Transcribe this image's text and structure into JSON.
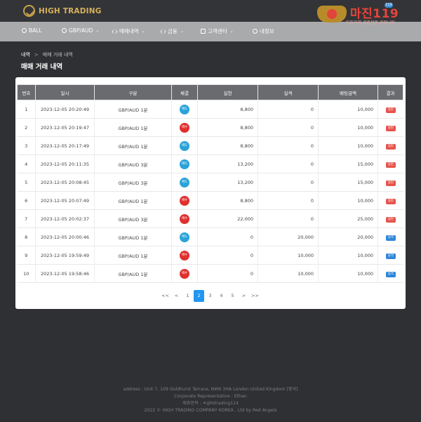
{
  "header": {
    "logo_text": "HIGH TRADING"
  },
  "watermark": {
    "title": "마진119",
    "subtitle": "마진거래 검증전문 커뮤니티",
    "badge": "119"
  },
  "nav": [
    {
      "label": "BALL",
      "icon": "ball-icon",
      "caret": ""
    },
    {
      "label": "GBP/AUD",
      "icon": "currency-icon",
      "caret": "⌄"
    },
    {
      "label": "매매내역",
      "icon": "chart-bars-icon",
      "caret": "⌄"
    },
    {
      "label": "금융",
      "icon": "finance-icon",
      "caret": "⌄"
    },
    {
      "label": "고객센터",
      "icon": "support-icon",
      "caret": "⌄"
    },
    {
      "label": "내정보",
      "icon": "user-icon",
      "caret": ""
    }
  ],
  "breadcrumb": {
    "home": "내역",
    "separator": ">",
    "current": "매매 거래 내역"
  },
  "page_title": "매매 거래 내역",
  "table": {
    "headers": [
      "번호",
      "일시",
      "구분",
      "체결",
      "실현",
      "실격",
      "배팅금액",
      "결과"
    ],
    "rows": [
      {
        "no": "1",
        "time": "2023-12-05 20:20:49",
        "type": "GBP/AUD 1분",
        "side": "매도",
        "side_kind": "sell",
        "realized": "8,800",
        "fail": "0",
        "bet": "10,000",
        "result": "실현",
        "result_kind": "loss"
      },
      {
        "no": "2",
        "time": "2023-12-05 20:19:47",
        "type": "GBP/AUD 1분",
        "side": "매수",
        "side_kind": "buy",
        "realized": "8,800",
        "fail": "0",
        "bet": "10,000",
        "result": "실현",
        "result_kind": "loss"
      },
      {
        "no": "3",
        "time": "2023-12-05 20:17:49",
        "type": "GBP/AUD 1분",
        "side": "매도",
        "side_kind": "sell",
        "realized": "8,800",
        "fail": "0",
        "bet": "10,000",
        "result": "실현",
        "result_kind": "loss"
      },
      {
        "no": "4",
        "time": "2023-12-05 20:11:35",
        "type": "GBP/AUD 3분",
        "side": "매도",
        "side_kind": "sell",
        "realized": "13,200",
        "fail": "0",
        "bet": "15,000",
        "result": "실현",
        "result_kind": "loss"
      },
      {
        "no": "5",
        "time": "2023-12-05 20:08:45",
        "type": "GBP/AUD 3분",
        "side": "매도",
        "side_kind": "sell",
        "realized": "13,200",
        "fail": "0",
        "bet": "15,000",
        "result": "실현",
        "result_kind": "loss"
      },
      {
        "no": "6",
        "time": "2023-12-05 20:07:49",
        "type": "GBP/AUD 1분",
        "side": "매수",
        "side_kind": "buy",
        "realized": "8,800",
        "fail": "0",
        "bet": "10,000",
        "result": "실현",
        "result_kind": "loss"
      },
      {
        "no": "7",
        "time": "2023-12-05 20:02:37",
        "type": "GBP/AUD 3분",
        "side": "매수",
        "side_kind": "buy",
        "realized": "22,000",
        "fail": "0",
        "bet": "25,000",
        "result": "실현",
        "result_kind": "loss"
      },
      {
        "no": "8",
        "time": "2023-12-05 20:00:46",
        "type": "GBP/AUD 1분",
        "side": "매도",
        "side_kind": "sell",
        "realized": "0",
        "fail": "20,000",
        "bet": "20,000",
        "result": "실격",
        "result_kind": "win"
      },
      {
        "no": "9",
        "time": "2023-12-05 19:59:49",
        "type": "GBP/AUD 1분",
        "side": "매수",
        "side_kind": "buy",
        "realized": "0",
        "fail": "10,000",
        "bet": "10,000",
        "result": "실격",
        "result_kind": "win"
      },
      {
        "no": "10",
        "time": "2023-12-05 19:58:46",
        "type": "GBP/AUD 1분",
        "side": "매수",
        "side_kind": "buy",
        "realized": "0",
        "fail": "10,000",
        "bet": "10,000",
        "result": "실격",
        "result_kind": "win"
      }
    ]
  },
  "pagination": {
    "first": "<<",
    "prev": "<",
    "pages": [
      "1",
      "2",
      "3",
      "4",
      "5"
    ],
    "current": "2",
    "next": ">",
    "last": ">>"
  },
  "footer": {
    "address": "address : Unit 7, 109 Goldhurst Terrace, NW6 3HA London United Kingdom [영국]",
    "representative": "Corporate Representative : Ethan",
    "contact": "제휴문의 : ✈@hitrading114",
    "copyright": "2022 © HIGH TRADING COMPANY KOREA , Ltd by Red Angels"
  },
  "colors": {
    "accent": "#2196f3",
    "buy": "#e0302e",
    "sell": "#2aa3d9",
    "loss_tag": "#e5534b",
    "win_tag": "#2f86d8",
    "logo": "#d6b15b"
  }
}
